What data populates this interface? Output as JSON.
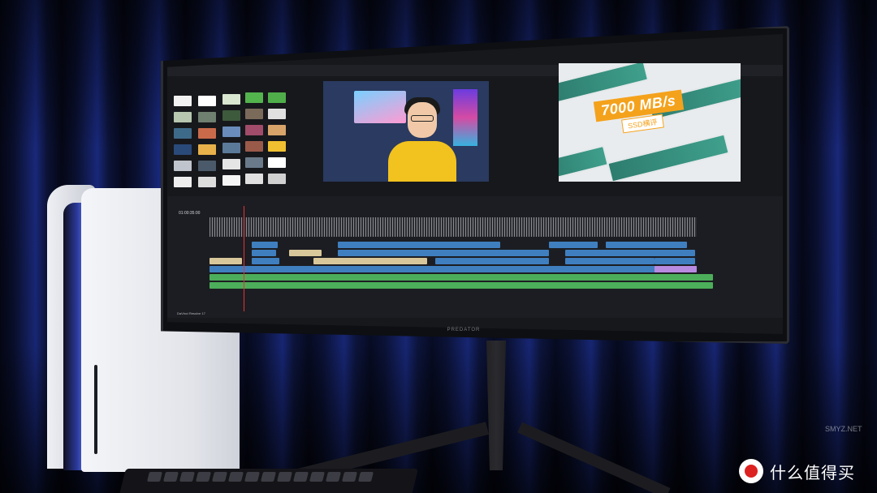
{
  "scene": {
    "description_tags": [
      "monitor",
      "game-console",
      "keyboard",
      "stand",
      "video-editor"
    ]
  },
  "editor": {
    "viewer_right_title": "7000 MB/s",
    "viewer_right_subtitle": "SSD横评",
    "timecode": "01:00:35:00",
    "footer_app": "DaVinci Resolve 17"
  },
  "monitor": {
    "brand": "PREDATOR"
  },
  "watermark": {
    "text": "什么值得买",
    "corner": "SMYZ.NET"
  },
  "colors": {
    "clip_blue": "#3f7fc0",
    "clip_green": "#4cae5a",
    "clip_tan": "#d8c79a",
    "clip_purple": "#b88ae0",
    "accent_orange": "#f4a21c"
  }
}
